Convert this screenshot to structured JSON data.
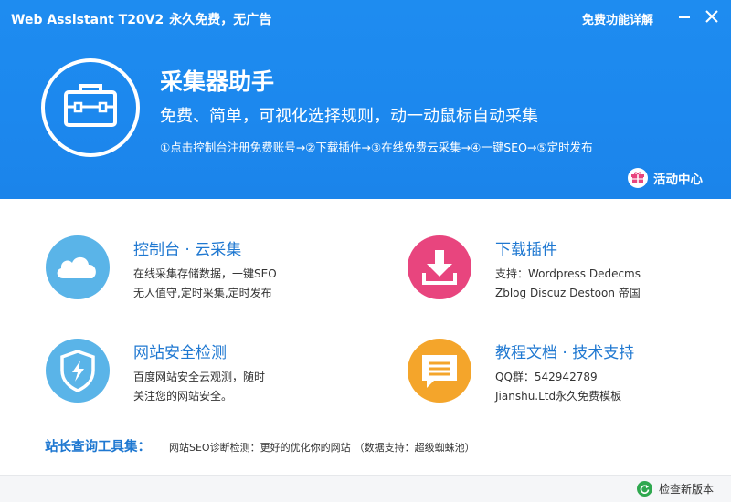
{
  "window": {
    "title": "Web Assistant T20V2",
    "slogan": "永久免费，无广告",
    "feature_link": "免费功能详解"
  },
  "hero": {
    "title": "采集器助手",
    "subtitle": "免费、简单，可视化选择规则，动一动鼠标自动采集",
    "steps": "①点击控制台注册免费账号→②下载插件→③在线免费云采集→④一键SEO→⑤定时发布",
    "activity_label": "活动中心"
  },
  "cards": {
    "console": {
      "title": "控制台 · 云采集",
      "line1": "在线采集存储数据，一键SEO",
      "line2": "无人值守,定时采集,定时发布",
      "icon": "cloud-icon",
      "color": "#5ab4e8"
    },
    "plugin": {
      "title": "下载插件",
      "line1": "支持：Wordpress Dedecms",
      "line2": "Zblog Discuz Destoon 帝国",
      "icon": "download-icon",
      "color": "#e8457e"
    },
    "security": {
      "title": "网站安全检测",
      "line1": "百度网站安全云观测，随时",
      "line2": "关注您的网站安全。",
      "icon": "shield-icon",
      "color": "#5ab4e8"
    },
    "docs": {
      "title": "教程文档 · 技术支持",
      "line1": "QQ群：542942789",
      "line2": "Jianshu.Ltd永久免费模板",
      "icon": "message-icon",
      "color": "#f4a52b"
    }
  },
  "tools": {
    "label": "站长查询工具集：",
    "link": "网站SEO诊断检测：更好的优化你的网站",
    "note": "（数据支持：超级蜘蛛池）"
  },
  "footer": {
    "update_label": "检查新版本"
  },
  "colors": {
    "header_blue": "#1e8cf0",
    "link_blue": "#1f78d1",
    "activity_pink": "#e8457e",
    "update_green": "#2fa84f"
  }
}
